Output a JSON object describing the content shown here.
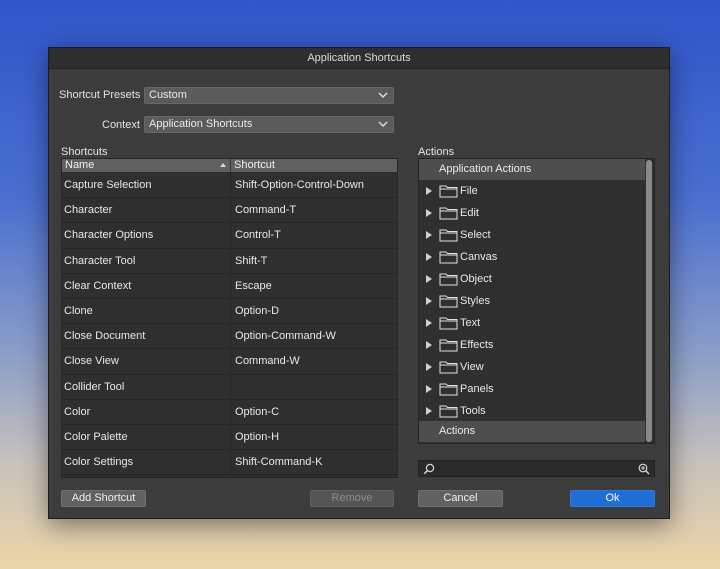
{
  "dialog": {
    "title": "Application Shortcuts"
  },
  "presets": {
    "label": "Shortcut Presets",
    "value": "Custom"
  },
  "context": {
    "label": "Context",
    "value": "Application Shortcuts"
  },
  "shortcuts": {
    "title": "Shortcuts",
    "columns": {
      "name": "Name",
      "shortcut": "Shortcut"
    },
    "rows": [
      {
        "name": "Capture Selection",
        "shortcut": "Shift-Option-Control-Down"
      },
      {
        "name": "Character",
        "shortcut": "Command-T"
      },
      {
        "name": "Character Options",
        "shortcut": "Control-T"
      },
      {
        "name": "Character Tool",
        "shortcut": "Shift-T"
      },
      {
        "name": "Clear Context",
        "shortcut": "Escape"
      },
      {
        "name": "Clone",
        "shortcut": "Option-D"
      },
      {
        "name": "Close Document",
        "shortcut": "Option-Command-W"
      },
      {
        "name": "Close View",
        "shortcut": "Command-W"
      },
      {
        "name": "Collider Tool",
        "shortcut": ""
      },
      {
        "name": "Color",
        "shortcut": "Option-C"
      },
      {
        "name": "Color Palette",
        "shortcut": "Option-H"
      },
      {
        "name": "Color Settings",
        "shortcut": "Shift-Command-K"
      }
    ]
  },
  "actions": {
    "title": "Actions",
    "group_top": "Application Actions",
    "items": [
      "File",
      "Edit",
      "Select",
      "Canvas",
      "Object",
      "Styles",
      "Text",
      "Effects",
      "View",
      "Panels",
      "Tools"
    ],
    "group_bottom": "Actions"
  },
  "search": {
    "value": "",
    "placeholder": ""
  },
  "buttons": {
    "add_shortcut": "Add Shortcut",
    "remove": "Remove",
    "cancel": "Cancel",
    "ok": "Ok"
  },
  "colors": {
    "accent": "#1f6ed6",
    "dialog_bg": "#3c3c3c"
  }
}
